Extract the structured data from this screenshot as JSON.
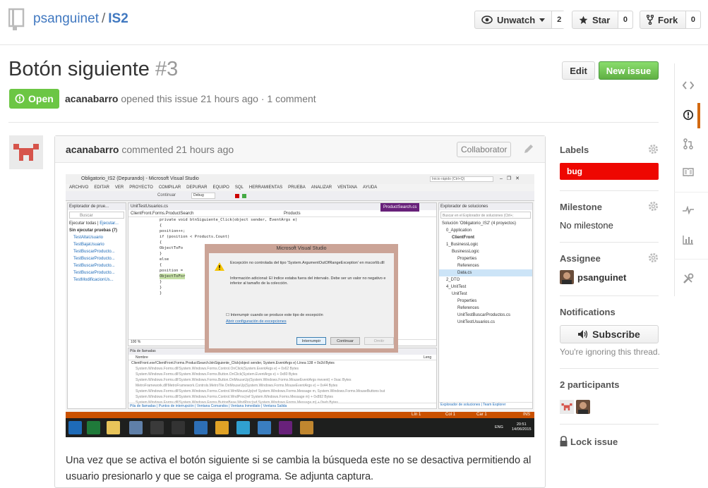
{
  "repo": {
    "owner": "psanguinet",
    "separator": "/",
    "name": "IS2"
  },
  "header_buttons": {
    "watch": {
      "label": "Unwatch",
      "count": "2"
    },
    "star": {
      "label": "Star",
      "count": "0"
    },
    "fork": {
      "label": "Fork",
      "count": "0"
    }
  },
  "issue": {
    "title": "Botón siguiente",
    "number": "#3",
    "state": "Open",
    "author": "acanabarro",
    "opened_text": "opened this issue 21 hours ago",
    "dot": "·",
    "comments_text": "1 comment",
    "edit_label": "Edit",
    "new_issue_label": "New issue"
  },
  "comment": {
    "author": "acanabarro",
    "action": "commented 21 hours ago",
    "badge": "Collaborator",
    "body": "Una vez que se activa el botón siguiente si se cambia la búsqueda este no se desactiva permitiendo al usuario presionarlo y que se caiga el programa. Se adjunta captura."
  },
  "screenshot": {
    "window_title": "Obligatorio_IS2 (Depurando) - Microsoft Visual Studio",
    "quick_launch": "Inicio rápido (Ctrl+Q)",
    "menu": [
      "ARCHIVO",
      "EDITAR",
      "VER",
      "PROYECTO",
      "COMPILAR",
      "DEPURAR",
      "EQUIPO",
      "SQL",
      "HERRAMIENTAS",
      "PRUEBA",
      "ANALIZAR",
      "VENTANA",
      "AYUDA"
    ],
    "toolbar_continue": "Continuar",
    "toolbar_config": "Debug",
    "test_explorer_title": "Explorador de prue...",
    "search_placeholder": "Buscar",
    "run_all": "Ejecutar todas",
    "run_menu": "Ejecutar...",
    "not_run_header": "Sin ejecutar pruebas (7)",
    "tests": [
      "TestAltaUsuario",
      "TestBajaUsuario",
      "TestBuscarProducto...",
      "TestBuscarProducto...",
      "TestBuscarProducto...",
      "TestBuscarProducto...",
      "TestModificacionUs..."
    ],
    "tab_file": "UnitTestUsuarios.cs",
    "tab_active": "ProductSearch.cs",
    "nav_left": "ClientFront.Forms.ProductSearch",
    "nav_right": "Products",
    "code": [
      "private void btnSiguiente_Click(object sender, EventArgs e)",
      "{",
      "    position++;",
      "    if (position < Products.Count)",
      "    {",
      "        ObjectToFo",
      "    }",
      "    else",
      "    {",
      "        position =",
      "        ObjectToFor",
      "    }",
      "}",
      "}"
    ],
    "zoom": "100 %",
    "dialog": {
      "title": "Microsoft Visual Studio",
      "message": "Excepción no controlada del tipo 'System.ArgumentOutOfRangeException' en mscorlib.dll",
      "detail": "Información adicional: El índice estaba fuera del intervalo. Debe ser un valor no negativo e inferior al tamaño de la colección.",
      "checkbox": "Interrumpir cuando se produce este tipo de excepción",
      "link": "Abrir configuración de excepciones",
      "btn_break": "Interrumpir",
      "btn_continue": "Continuar",
      "btn_ignore": "Omitir"
    },
    "solution_title": "Explorador de soluciones",
    "solution_search": "Buscar en el Explorador de soluciones (Ctrl+;",
    "solution_items": [
      "Solución 'Obligatorio_IS2' (4 proyectos)",
      "0_Application",
      "ClientFront",
      "1_BusinessLogic",
      "BusinessLogic",
      "Properties",
      "References",
      "Data.cs",
      "2_DTO",
      "4_UnitTest",
      "UnitTest",
      "Properties",
      "References",
      "UnitTestBuscarProductos.cs",
      "UnitTestUsuarios.cs"
    ],
    "callstack_title": "Pila de llamadas",
    "callstack_col_name": "Nombre",
    "callstack_col_lang": "Leng",
    "callstack_rows": [
      "ClientFront.exe!ClientFront.Forms.ProductSearch.btnSiguiente_Click(object sender, System.EventArgs e) Línea 138 + 0x2d Bytes",
      "System.Windows.Forms.dll!System.Windows.Forms.Control.OnClick(System.EventArgs e) + 0x62 Bytes",
      "System.Windows.Forms.dll!System.Windows.Forms.Button.OnClick(System.EventArgs e) + 0x80 Bytes",
      "System.Windows.Forms.dll!System.Windows.Forms.Button.OnMouseUp(System.Windows.Forms.MouseEventArgs mevent) + 0xac Bytes",
      "MetroFramework.dll!MetroFramework.Controls.MetroTile.OnMouseUp(System.Windows.Forms.MouseEventArgs e) + 0x44 Bytes",
      "System.Windows.Forms.dll!System.Windows.Forms.Control.WmMouseUp(ref System.Windows.Forms.Message m, System.Windows.Forms.MouseButtons but",
      "System.Windows.Forms.dll!System.Windows.Forms.Control.WndProc(ref System.Windows.Forms.Message m) + 0x892 Bytes",
      "System.Windows.Forms.dll!System.Windows.Forms.ButtonBase.WndProc(ref System.Windows.Forms.Message m) + 0xeb Bytes"
    ],
    "bottom_tabs": [
      "Pila de llamadas",
      "Puntos de interrupción",
      "Ventana Comandos",
      "Ventana Inmediato",
      "Ventana Salida"
    ],
    "solution_tabs": [
      "Explorador de soluciones",
      "Team Explorer"
    ],
    "status": {
      "line": "Lín 1",
      "col": "Col 1",
      "car": "Car 1",
      "ins": "INS"
    },
    "tray": {
      "lang": "ENG",
      "time": "20:51",
      "date": "14/06/2015"
    }
  },
  "sidebar": {
    "labels_title": "Labels",
    "label_bug": "bug",
    "milestone_title": "Milestone",
    "milestone_value": "No milestone",
    "assignee_title": "Assignee",
    "assignee_name": "psanguinet",
    "notifications_title": "Notifications",
    "subscribe_label": "Subscribe",
    "ignoring_text": "You're ignoring this thread.",
    "participants_title": "2 participants",
    "lock_label": "Lock issue"
  },
  "colors": {
    "open": "#6cc644",
    "bug": "#ee0701",
    "new_issue": "#60b044",
    "link": "#4078c0",
    "active_nav": "#d26911"
  }
}
